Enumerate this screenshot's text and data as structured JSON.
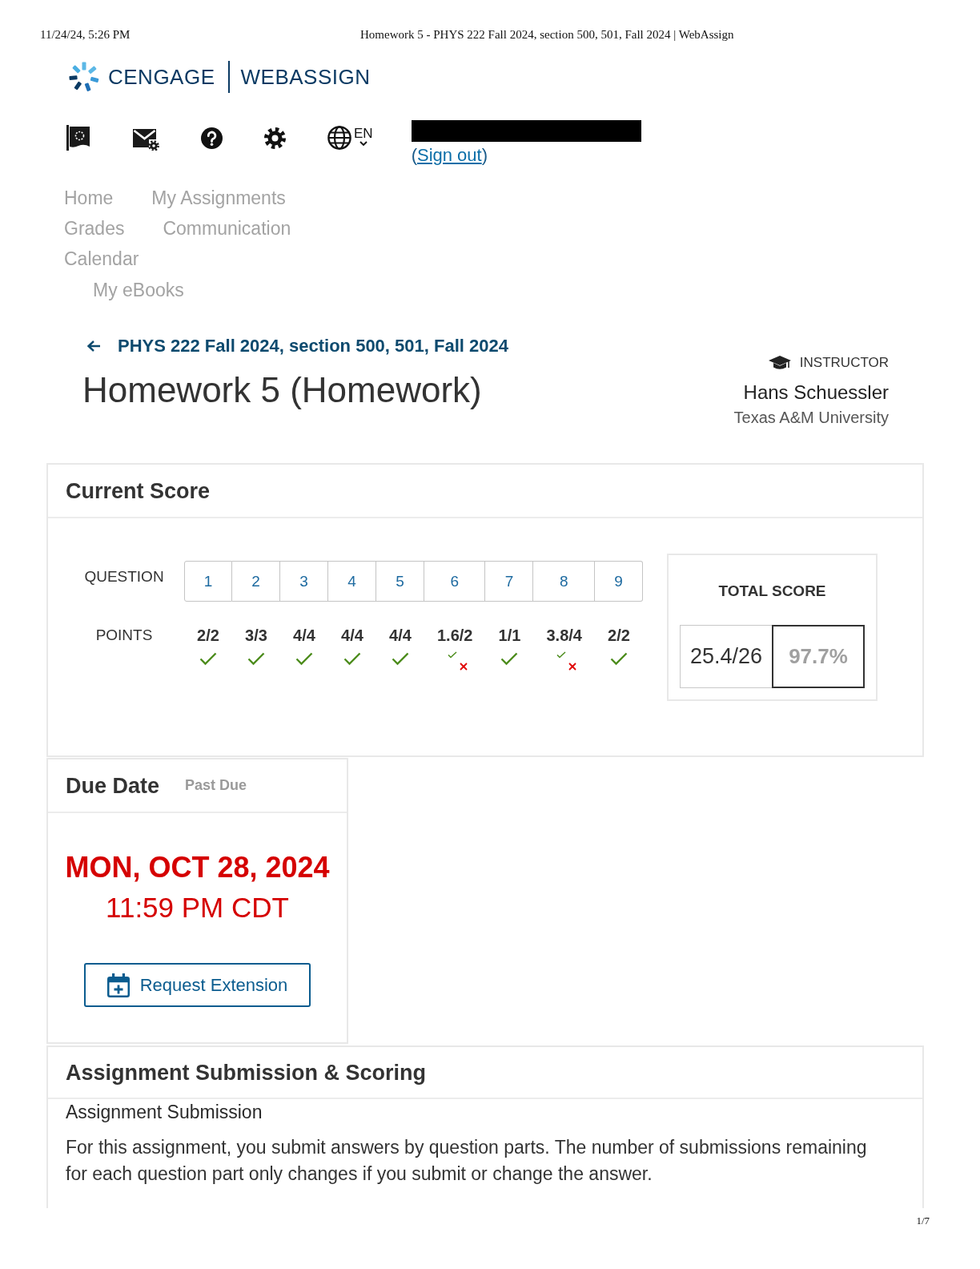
{
  "print_header": {
    "timestamp": "11/24/24, 5:26 PM",
    "page_title": "Homework 5 - PHYS 222 Fall 2024, section 500, 501, Fall 2024 | WebAssign"
  },
  "logo": {
    "brand": "CENGAGE",
    "product": "WEBASSIGN"
  },
  "toolbar": {
    "language": "EN",
    "sign_out": {
      "before": "(",
      "link": "Sign out",
      "after": ")"
    }
  },
  "nav": {
    "rows": [
      [
        "Home",
        "My Assignments"
      ],
      [
        "Grades",
        "Communication"
      ],
      [
        "Calendar"
      ]
    ],
    "ebooks": "My eBooks"
  },
  "course": {
    "link": "PHYS 222 Fall 2024, section 500, 501, Fall 2024",
    "title": "Homework 5 (Homework)"
  },
  "instructor": {
    "label": "INSTRUCTOR",
    "name": "Hans Schuessler",
    "school": "Texas A&M University"
  },
  "current_score": {
    "title": "Current Score",
    "question_label": "QUESTION",
    "points_label": "POINTS",
    "questions": [
      {
        "number": "1",
        "points": "2/2",
        "kind": "correct"
      },
      {
        "number": "2",
        "points": "3/3",
        "kind": "correct"
      },
      {
        "number": "3",
        "points": "4/4",
        "kind": "correct"
      },
      {
        "number": "4",
        "points": "4/4",
        "kind": "correct"
      },
      {
        "number": "5",
        "points": "4/4",
        "kind": "correct"
      },
      {
        "number": "6",
        "points": "1.6/2",
        "kind": "partial"
      },
      {
        "number": "7",
        "points": "1/1",
        "kind": "correct"
      },
      {
        "number": "8",
        "points": "3.8/4",
        "kind": "partial"
      },
      {
        "number": "9",
        "points": "2/2",
        "kind": "correct"
      }
    ],
    "total": {
      "label": "TOTAL SCORE",
      "points": "25.4/26",
      "percent": "97.7%"
    }
  },
  "due_date": {
    "title": "Due Date",
    "status": "Past Due",
    "date": "MON, OCT 28, 2024",
    "time": "11:59 PM CDT",
    "button": "Request Extension"
  },
  "submission": {
    "title": "Assignment Submission & Scoring",
    "subtitle": "Assignment Submission",
    "text": "For this assignment, you submit answers by question parts. The number of submissions remaining for each question part only changes if you submit or change the answer."
  },
  "page_number": "1/7"
}
